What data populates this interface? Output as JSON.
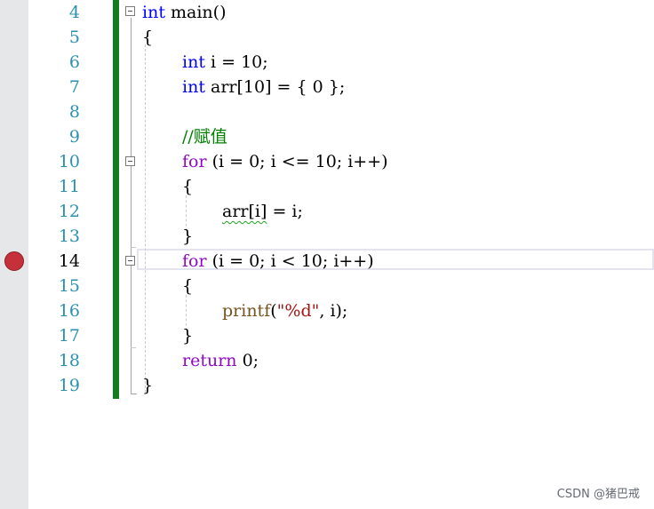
{
  "editor": {
    "lines": [
      {
        "number": "4"
      },
      {
        "number": "5"
      },
      {
        "number": "6"
      },
      {
        "number": "7"
      },
      {
        "number": "8"
      },
      {
        "number": "9"
      },
      {
        "number": "10"
      },
      {
        "number": "11"
      },
      {
        "number": "12"
      },
      {
        "number": "13"
      },
      {
        "number": "14"
      },
      {
        "number": "15"
      },
      {
        "number": "16"
      },
      {
        "number": "17"
      },
      {
        "number": "18"
      },
      {
        "number": "19"
      }
    ],
    "tokens": {
      "l4_kw": "int",
      "l4_rest": " main()",
      "l5": "{",
      "l6_kw": "int",
      "l6_rest": " i = 10;",
      "l7_kw": "int",
      "l7_rest": " arr[10] = { 0 };",
      "l9_comment": "//赋值",
      "l10_kw": "for",
      "l10_rest": " (i = 0; i <= 10; i++)",
      "l11": "{",
      "l12_squiggle": "arr[i]",
      "l12_rest": " = i;",
      "l13": "}",
      "l14_kw": "for",
      "l14_rest": " (i = 0; i < 10; i++)",
      "l15": "{",
      "l16_fn": "printf",
      "l16_open": "(",
      "l16_str": "\"%d\"",
      "l16_rest": ", i);",
      "l17": "}",
      "l18_kw": "return",
      "l18_rest": " 0;",
      "l19": "}"
    },
    "current_line": "14",
    "breakpoint_line": "14",
    "colors": {
      "keyword": "#0000ff",
      "control": "#8f08c4",
      "function": "#74531f",
      "string": "#a31515",
      "comment": "#008000",
      "changebar": "#117d1f",
      "breakpoint": "#c5303a"
    }
  },
  "watermark": "CSDN @猪巴戒"
}
